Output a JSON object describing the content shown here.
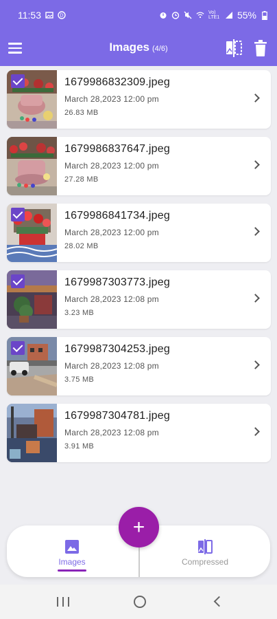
{
  "status": {
    "time": "11:53",
    "battery": "55%",
    "network": "Vo) LTE1"
  },
  "app": {
    "title": "Images",
    "count": "(4/6)"
  },
  "colors": {
    "primary": "#7c6ae6",
    "fab": "#9a1ea8",
    "check": "#6b45c8"
  },
  "files": [
    {
      "name": "1679986832309.jpeg",
      "date": "March 28,2023 12:00 pm",
      "size": "26.83 MB",
      "checked": true
    },
    {
      "name": "1679986837647.jpeg",
      "date": "March 28,2023 12:00 pm",
      "size": "27.28 MB",
      "checked": false
    },
    {
      "name": "1679986841734.jpeg",
      "date": "March 28,2023 12:00 pm",
      "size": "28.02 MB",
      "checked": true
    },
    {
      "name": "1679987303773.jpeg",
      "date": "March 28,2023 12:08 pm",
      "size": "3.23 MB",
      "checked": true
    },
    {
      "name": "1679987304253.jpeg",
      "date": "March 28,2023 12:08 pm",
      "size": "3.75 MB",
      "checked": true
    },
    {
      "name": "1679987304781.jpeg",
      "date": "March 28,2023 12:08 pm",
      "size": "3.91 MB",
      "checked": false
    }
  ],
  "nav": {
    "images_label": "Images",
    "compressed_label": "Compressed",
    "fab_label": "+"
  },
  "icons": {
    "menu": "menu-icon",
    "compare": "compare-icon",
    "delete": "trash-icon",
    "images": "image-icon",
    "compressed": "compress-icon",
    "add": "plus-icon"
  }
}
